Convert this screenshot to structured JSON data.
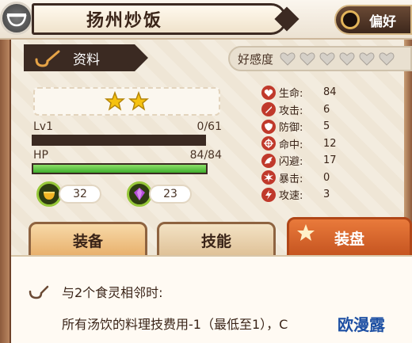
{
  "header": {
    "title": "扬州炒饭",
    "preference_label": "偏好",
    "info_tab_label": "资料",
    "affection_label": "好感度",
    "affection_hearts": 6
  },
  "card": {
    "stars": 2,
    "level_label": "Lv1",
    "exp_text": "0/61",
    "exp_fraction": 0,
    "hp_label": "HP",
    "hp_text": "84/84",
    "hp_fraction": 1,
    "resources": [
      {
        "icon": "gold-ingredient-icon",
        "value": "32"
      },
      {
        "icon": "purple-gem-icon",
        "value": "23"
      }
    ]
  },
  "stats": [
    {
      "icon": "heart-icon",
      "label": "生命:",
      "value": "84"
    },
    {
      "icon": "sword-icon",
      "label": "攻击:",
      "value": "6"
    },
    {
      "icon": "shield-icon",
      "label": "防御:",
      "value": "5"
    },
    {
      "icon": "crosshair-icon",
      "label": "命中:",
      "value": "12"
    },
    {
      "icon": "wing-icon",
      "label": "闪避:",
      "value": "17"
    },
    {
      "icon": "burst-icon",
      "label": "暴击:",
      "value": "0"
    },
    {
      "icon": "lightning-icon",
      "label": "攻速:",
      "value": "3"
    }
  ],
  "tabs": [
    {
      "label": "装备"
    },
    {
      "label": "技能"
    },
    {
      "label": "装盘"
    }
  ],
  "plate": {
    "condition": "与2个食灵相邻时:",
    "effect": "所有汤饮的料理技费用-1（最低至1），C"
  },
  "watermark": "欧漫露",
  "colors": {
    "hp_bar": "#3fae2c",
    "active_tab": "#e97a3b",
    "stat_icon": "#c0392b"
  }
}
